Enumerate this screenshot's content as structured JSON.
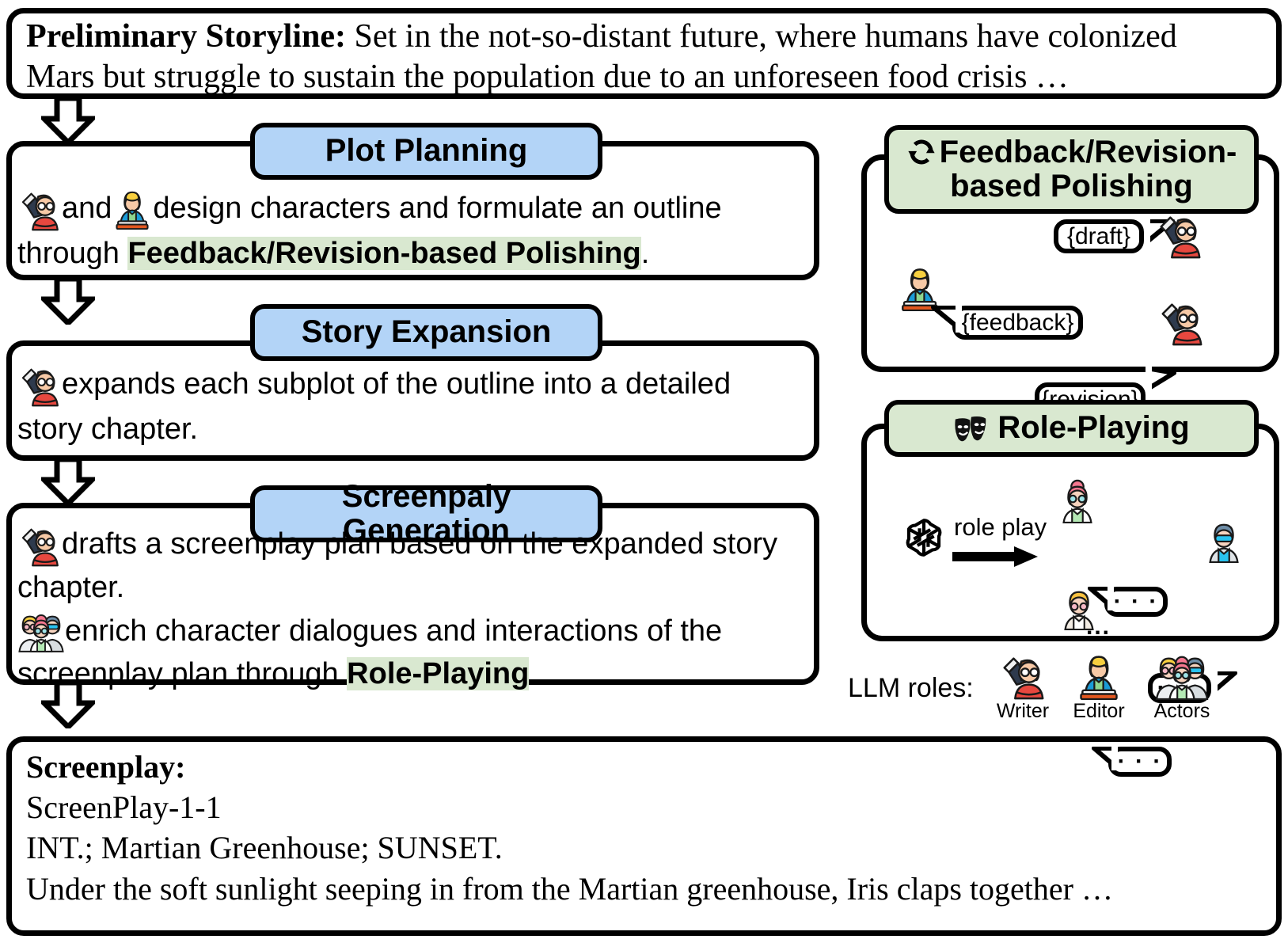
{
  "preliminary": {
    "label": "Preliminary Storyline",
    "colon": ":",
    "line1": " Set in the not-so-distant future, where humans have colonized",
    "line2": "Mars but struggle to sustain the population due to an unforeseen food crisis …"
  },
  "stages": [
    {
      "title": "Plot Planning",
      "line1_pre": " and ",
      "line1_post": " design characters and formulate an outline",
      "line2_pre": "through ",
      "line2_hl": "Feedback/Revision-based Polishing",
      "line2_post": "."
    },
    {
      "title": "Story Expansion",
      "line1_post": " expands each subplot of the outline into a detailed",
      "line2_pre": "story chapter."
    },
    {
      "title": "Screenpaly Generation",
      "line1_post": " drafts a screenplay plan based on the expanded story",
      "line2_pre": "chapter.",
      "line3_post": " enrich character dialogues and interactions of the",
      "line4_pre": "screenplay plan through ",
      "line4_hl": "Role-Playing",
      "line4_post": "."
    }
  ],
  "feedback_panel": {
    "icon": "cycle-arrows-icon",
    "title_line1": "Feedback/Revision-",
    "title_line2": "based Polishing",
    "bubbles": {
      "draft": "{draft}",
      "feedback": "{feedback}",
      "revision": "{revision}"
    }
  },
  "roleplay_panel": {
    "icon": "theater-masks-icon",
    "title": "Role-Playing",
    "model_icon": "openai-logo-icon",
    "arrow_label": "role play",
    "bubble_text": "· · ·",
    "ellipsis": "..."
  },
  "legend": {
    "label": "LLM roles:",
    "items": [
      {
        "icon": "writer-avatar-icon",
        "label": "Writer"
      },
      {
        "icon": "editor-avatar-icon",
        "label": "Editor"
      },
      {
        "icon": "actors-avatar-icon",
        "label": "Actors"
      }
    ]
  },
  "screenplay": {
    "label": "Screenplay",
    "colon": ":",
    "line1": "ScreenPlay-1-1",
    "line2": "INT.; Martian Greenhouse; SUNSET.",
    "line3": "Under the soft sunlight seeping in from the Martian greenhouse, Iris claps together …"
  },
  "colors": {
    "stage_header": "#b3d4f7",
    "method_header": "#d9e8d0",
    "highlight": "#d9e8d0",
    "outline": "#000000",
    "background": "#ffffff"
  }
}
